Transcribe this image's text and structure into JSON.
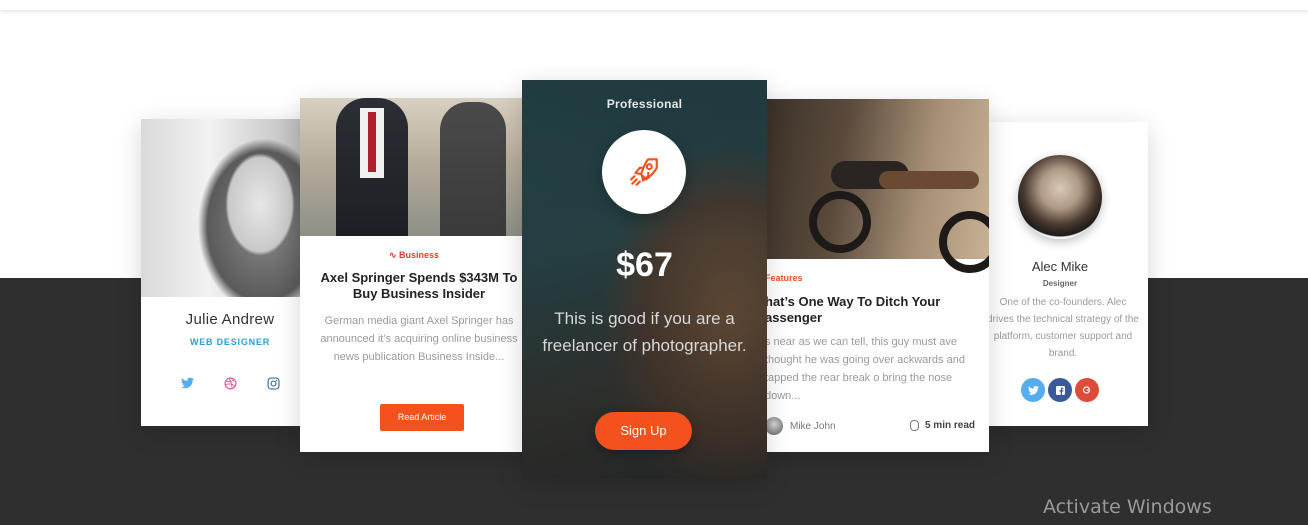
{
  "profile_left": {
    "name": "Julie Andrew",
    "role": "WEB DESIGNER",
    "social_icons": [
      "twitter-icon",
      "dribbble-icon",
      "instagram-icon"
    ]
  },
  "article_left": {
    "category": "Business",
    "title": "Axel Springer Spends $343M To Buy Business Insider",
    "body": "German media giant Axel Springer has announced it’s acquiring online business news publication Business Inside...",
    "button_label": "Read Article"
  },
  "pricing": {
    "plan": "Professional",
    "icon": "rocket-icon",
    "price": "$67",
    "description": "This is good if you are a freelancer of photographer.",
    "button_label": "Sign Up"
  },
  "article_right": {
    "category": "Features",
    "title": "hat’s One Way To Ditch Your assenger",
    "body": "s near as we can tell, this guy must ave thought he was going over ackwards and tapped the rear break o bring the nose down...",
    "author": "Mike John",
    "read_time": "5 min read"
  },
  "profile_right": {
    "name": "Alec Mike",
    "role": "Designer",
    "bio": "One of the co-founders. Alec drives the technical strategy of the platform, customer support and brand.",
    "social_icons": [
      "twitter-icon",
      "facebook-icon",
      "google-plus-icon"
    ]
  },
  "watermark": "Activate Windows",
  "colors": {
    "accent": "#f4511e",
    "dark_band": "#2f2f2f",
    "role_blue": "#2a9fd6",
    "category_red": "#e53935"
  }
}
